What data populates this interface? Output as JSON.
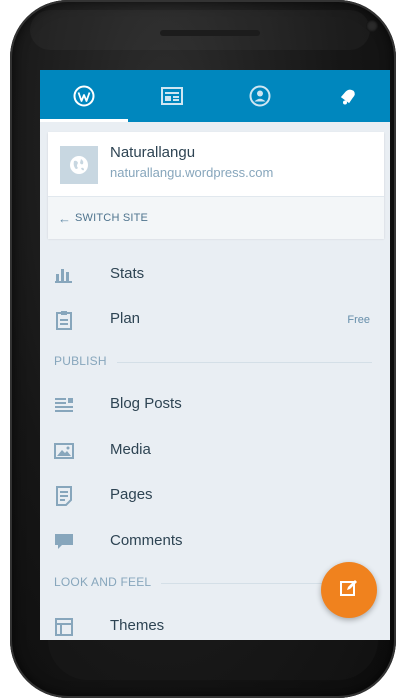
{
  "colors": {
    "brand_blue": "#0087be",
    "fab_orange": "#f0821e",
    "screen_bg": "#e9eef3",
    "text_primary": "#2e4453",
    "text_muted": "#87a6bc"
  },
  "tabs": [
    {
      "icon": "wordpress-logo-icon",
      "active": true
    },
    {
      "icon": "reader-icon",
      "active": false
    },
    {
      "icon": "me-profile-icon",
      "active": false
    },
    {
      "icon": "notifications-bell-icon",
      "active": false
    }
  ],
  "site": {
    "name": "Naturallangu",
    "url": "naturallangu.wordpress.com",
    "icon": "globe-icon",
    "switch_label": "SWITCH SITE"
  },
  "menu": {
    "stats": {
      "label": "Stats",
      "icon": "stats-icon"
    },
    "plan": {
      "label": "Plan",
      "badge": "Free",
      "icon": "plan-icon"
    },
    "publish_header": "PUBLISH",
    "blog_posts": {
      "label": "Blog Posts",
      "icon": "posts-icon"
    },
    "media": {
      "label": "Media",
      "icon": "media-icon"
    },
    "pages": {
      "label": "Pages",
      "icon": "pages-icon"
    },
    "comments": {
      "label": "Comments",
      "icon": "comments-icon"
    },
    "look_header": "LOOK AND FEEL",
    "themes": {
      "label": "Themes",
      "icon": "themes-icon"
    }
  },
  "fab": {
    "icon": "compose-edit-icon"
  }
}
